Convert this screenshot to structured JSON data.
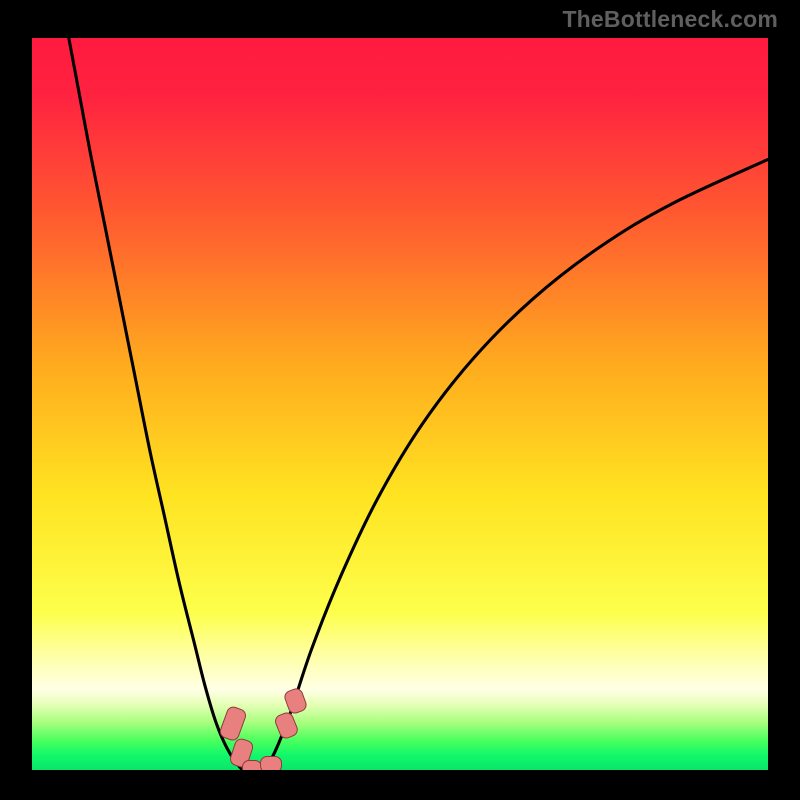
{
  "watermark": "TheBottleneck.com",
  "chart_data": {
    "type": "line",
    "title": "",
    "xlabel": "",
    "ylabel": "",
    "xlim": [
      0,
      100
    ],
    "ylim": [
      0,
      100
    ],
    "gradient_stops": [
      {
        "offset": 0,
        "color": "#ff1a3f"
      },
      {
        "offset": 0.08,
        "color": "#ff2340"
      },
      {
        "offset": 0.25,
        "color": "#ff5d2f"
      },
      {
        "offset": 0.45,
        "color": "#ffad1e"
      },
      {
        "offset": 0.62,
        "color": "#ffe321"
      },
      {
        "offset": 0.78,
        "color": "#fdff4b"
      },
      {
        "offset": 0.84,
        "color": "#feffa6"
      },
      {
        "offset": 0.885,
        "color": "#ffffe6"
      },
      {
        "offset": 0.905,
        "color": "#e7ffb8"
      },
      {
        "offset": 0.93,
        "color": "#a8ff7e"
      },
      {
        "offset": 0.955,
        "color": "#49ff5e"
      },
      {
        "offset": 0.975,
        "color": "#11f76a"
      },
      {
        "offset": 1.0,
        "color": "#09e06b"
      }
    ],
    "series": [
      {
        "name": "left-branch",
        "x": [
          5.0,
          6.5,
          8.0,
          10.0,
          12.0,
          14.0,
          16.0,
          18.0,
          20.0,
          22.0,
          23.5,
          25.0,
          26.5,
          28.0,
          29.0,
          29.5,
          30.0
        ],
        "y": [
          100,
          92,
          84,
          74,
          64,
          54,
          44,
          35,
          26,
          18,
          12,
          7,
          3.5,
          1.2,
          0.3,
          0.1,
          0.0
        ]
      },
      {
        "name": "right-branch",
        "x": [
          30.0,
          30.8,
          31.6,
          33.0,
          35.0,
          38.0,
          42.0,
          47.0,
          53.0,
          60.0,
          68.0,
          77.0,
          87.0,
          100.0
        ],
        "y": [
          0.0,
          0.1,
          0.6,
          3.0,
          8.0,
          17.0,
          27.0,
          37.5,
          47.5,
          56.5,
          64.5,
          71.5,
          77.5,
          83.5
        ]
      }
    ],
    "markers": [
      {
        "name": "marker-left-upper",
        "x": 27.2,
        "y": 6.5,
        "w": 2.4,
        "h": 4.2,
        "angle": 20
      },
      {
        "name": "marker-left-lower",
        "x": 28.3,
        "y": 2.5,
        "w": 2.3,
        "h": 3.6,
        "angle": 18
      },
      {
        "name": "marker-bottom-1",
        "x": 29.8,
        "y": 0.4,
        "w": 2.4,
        "h": 2.0,
        "angle": 0
      },
      {
        "name": "marker-bottom-2",
        "x": 32.3,
        "y": 0.9,
        "w": 2.7,
        "h": 2.0,
        "angle": 0
      },
      {
        "name": "marker-right-lower",
        "x": 34.5,
        "y": 6.2,
        "w": 2.3,
        "h": 3.2,
        "angle": -22
      },
      {
        "name": "marker-right-upper",
        "x": 35.7,
        "y": 9.6,
        "w": 2.3,
        "h": 3.0,
        "angle": -20
      }
    ]
  }
}
